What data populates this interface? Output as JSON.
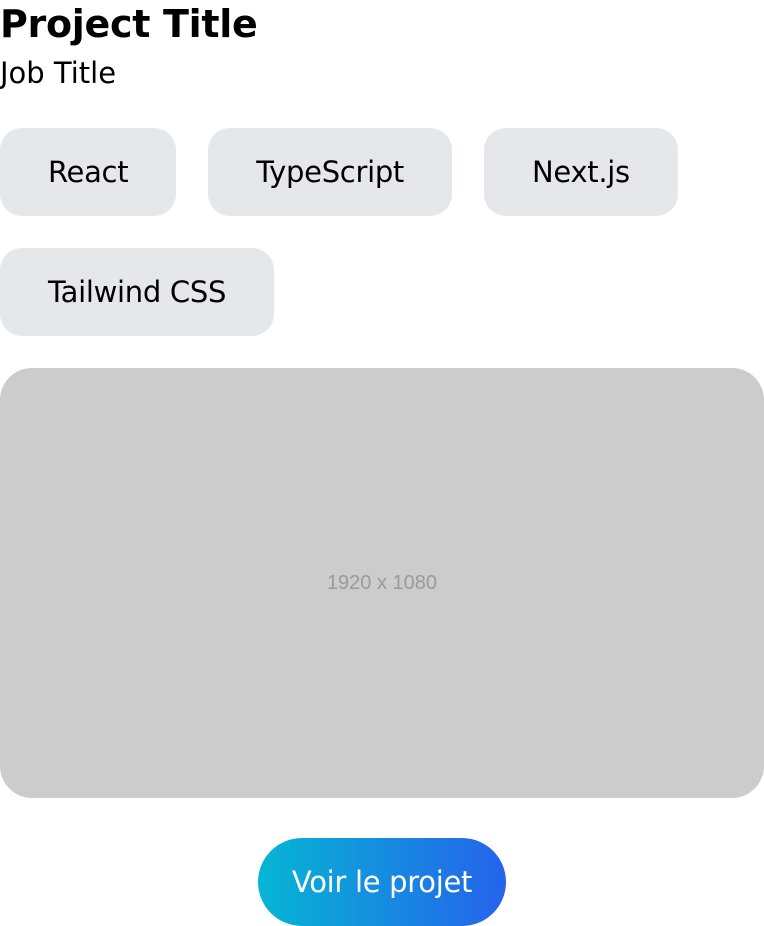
{
  "header": {
    "project_title": "Project Title",
    "job_title": "Job Title"
  },
  "tags": [
    {
      "label": "React"
    },
    {
      "label": "TypeScript"
    },
    {
      "label": "Next.js"
    },
    {
      "label": "Tailwind CSS"
    }
  ],
  "image": {
    "placeholder_text": "1920 x 1080",
    "background_color": "#cccccc"
  },
  "cta": {
    "label": "Voir le projet",
    "gradient_start": "#06b6d4",
    "gradient_end": "#2563eb"
  },
  "colors": {
    "tag_background": "#e5e7eb",
    "text": "#000000"
  }
}
